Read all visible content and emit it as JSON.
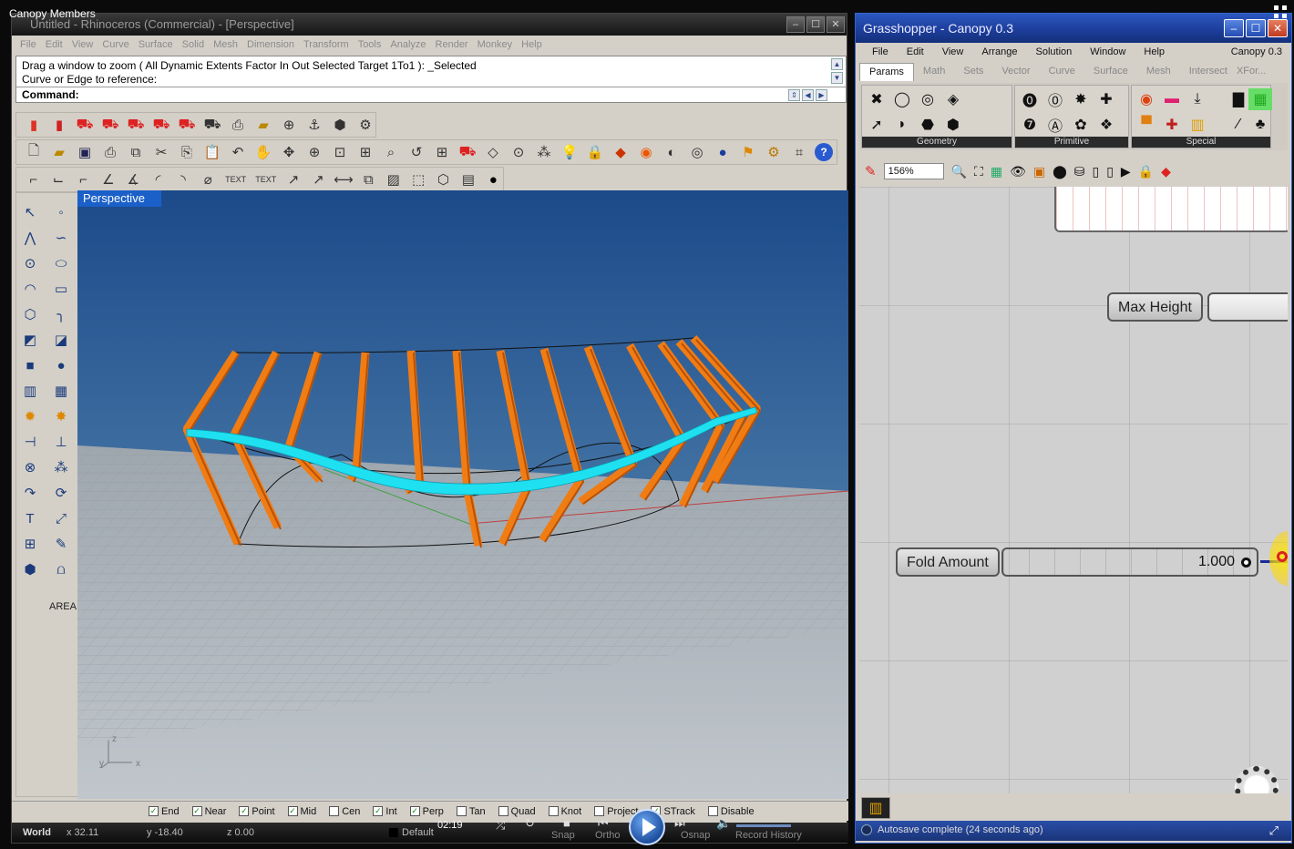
{
  "video": {
    "title": "Canopy Members",
    "time": "02:19"
  },
  "rhino": {
    "title": "Untitled - Rhinoceros (Commercial) - [Perspective]",
    "menu": [
      "File",
      "Edit",
      "View",
      "Curve",
      "Surface",
      "Solid",
      "Mesh",
      "Dimension",
      "Transform",
      "Tools",
      "Analyze",
      "Render",
      "Monkey",
      "Help"
    ],
    "command": {
      "line1": "Drag a window to zoom ( All  Dynamic  Extents  Factor  In  Out  Selected  Target  1To1 ):  _Selected",
      "line2": "Curve or Edge to reference:",
      "prompt": "Command:"
    },
    "viewport_label": "Perspective",
    "area_label": "AREA",
    "osnaps": [
      {
        "label": "End",
        "checked": true
      },
      {
        "label": "Near",
        "checked": true
      },
      {
        "label": "Point",
        "checked": true
      },
      {
        "label": "Mid",
        "checked": true
      },
      {
        "label": "Cen",
        "checked": false
      },
      {
        "label": "Int",
        "checked": true
      },
      {
        "label": "Perp",
        "checked": true
      },
      {
        "label": "Tan",
        "checked": false
      },
      {
        "label": "Quad",
        "checked": false
      },
      {
        "label": "Knot",
        "checked": false
      },
      {
        "label": "Project",
        "checked": false
      },
      {
        "label": "STrack",
        "checked": true
      },
      {
        "label": "Disable",
        "checked": false
      }
    ],
    "status": {
      "cplane": "World",
      "x": "x 32.11",
      "y": "y -18.40",
      "z": "z 0.00",
      "layer": "Default",
      "snap": "Snap",
      "ortho": "Ortho",
      "osnap": "Osnap",
      "record": "Record History"
    },
    "axes": {
      "x": "x",
      "y": "y",
      "z": "z"
    }
  },
  "grasshopper": {
    "title": "Grasshopper - Canopy 0.3",
    "menu": [
      "File",
      "Edit",
      "View",
      "Arrange",
      "Solution",
      "Window",
      "Help"
    ],
    "doc_name": "Canopy 0.3",
    "tabs": [
      "Params",
      "Math",
      "Sets",
      "Vector",
      "Curve",
      "Surface",
      "Mesh",
      "Intersect",
      "XFor..."
    ],
    "active_tab": "Params",
    "ribbon_groups": [
      "Geometry",
      "Primitive",
      "Special"
    ],
    "zoom": "156%",
    "nodes": {
      "max_height": {
        "label": "Max Height"
      },
      "fold_amount": {
        "label": "Fold Amount",
        "value": "1.000"
      }
    },
    "status": "Autosave complete (24 seconds ago)"
  }
}
